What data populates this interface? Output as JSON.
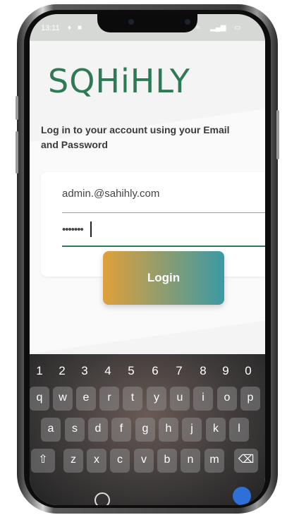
{
  "status_bar": {
    "time": "13:11",
    "icons": [
      "notification-icon",
      "app-icon",
      "alarm-icon",
      "vibrate-icon",
      "wifi-icon",
      "signal-icon",
      "battery-icon"
    ]
  },
  "app": {
    "logo": "SQHiHLY",
    "subtitle": "Log in to your account using your Email and Password",
    "email_value": "admin.@sahihly.com",
    "password_value": "•••••••",
    "login_label": "Login",
    "colors": {
      "brand_green": "#2e7a55",
      "button_gradient_start": "#e0a03a",
      "button_gradient_end": "#3b9aa4"
    }
  },
  "keyboard": {
    "numbers": [
      "1",
      "2",
      "3",
      "4",
      "5",
      "6",
      "7",
      "8",
      "9",
      "0"
    ],
    "row1": [
      "q",
      "w",
      "e",
      "r",
      "t",
      "y",
      "u",
      "i",
      "o",
      "p"
    ],
    "row2": [
      "a",
      "s",
      "d",
      "f",
      "g",
      "h",
      "j",
      "k",
      "l"
    ],
    "row3": [
      "z",
      "x",
      "c",
      "v",
      "b",
      "n",
      "m"
    ]
  }
}
